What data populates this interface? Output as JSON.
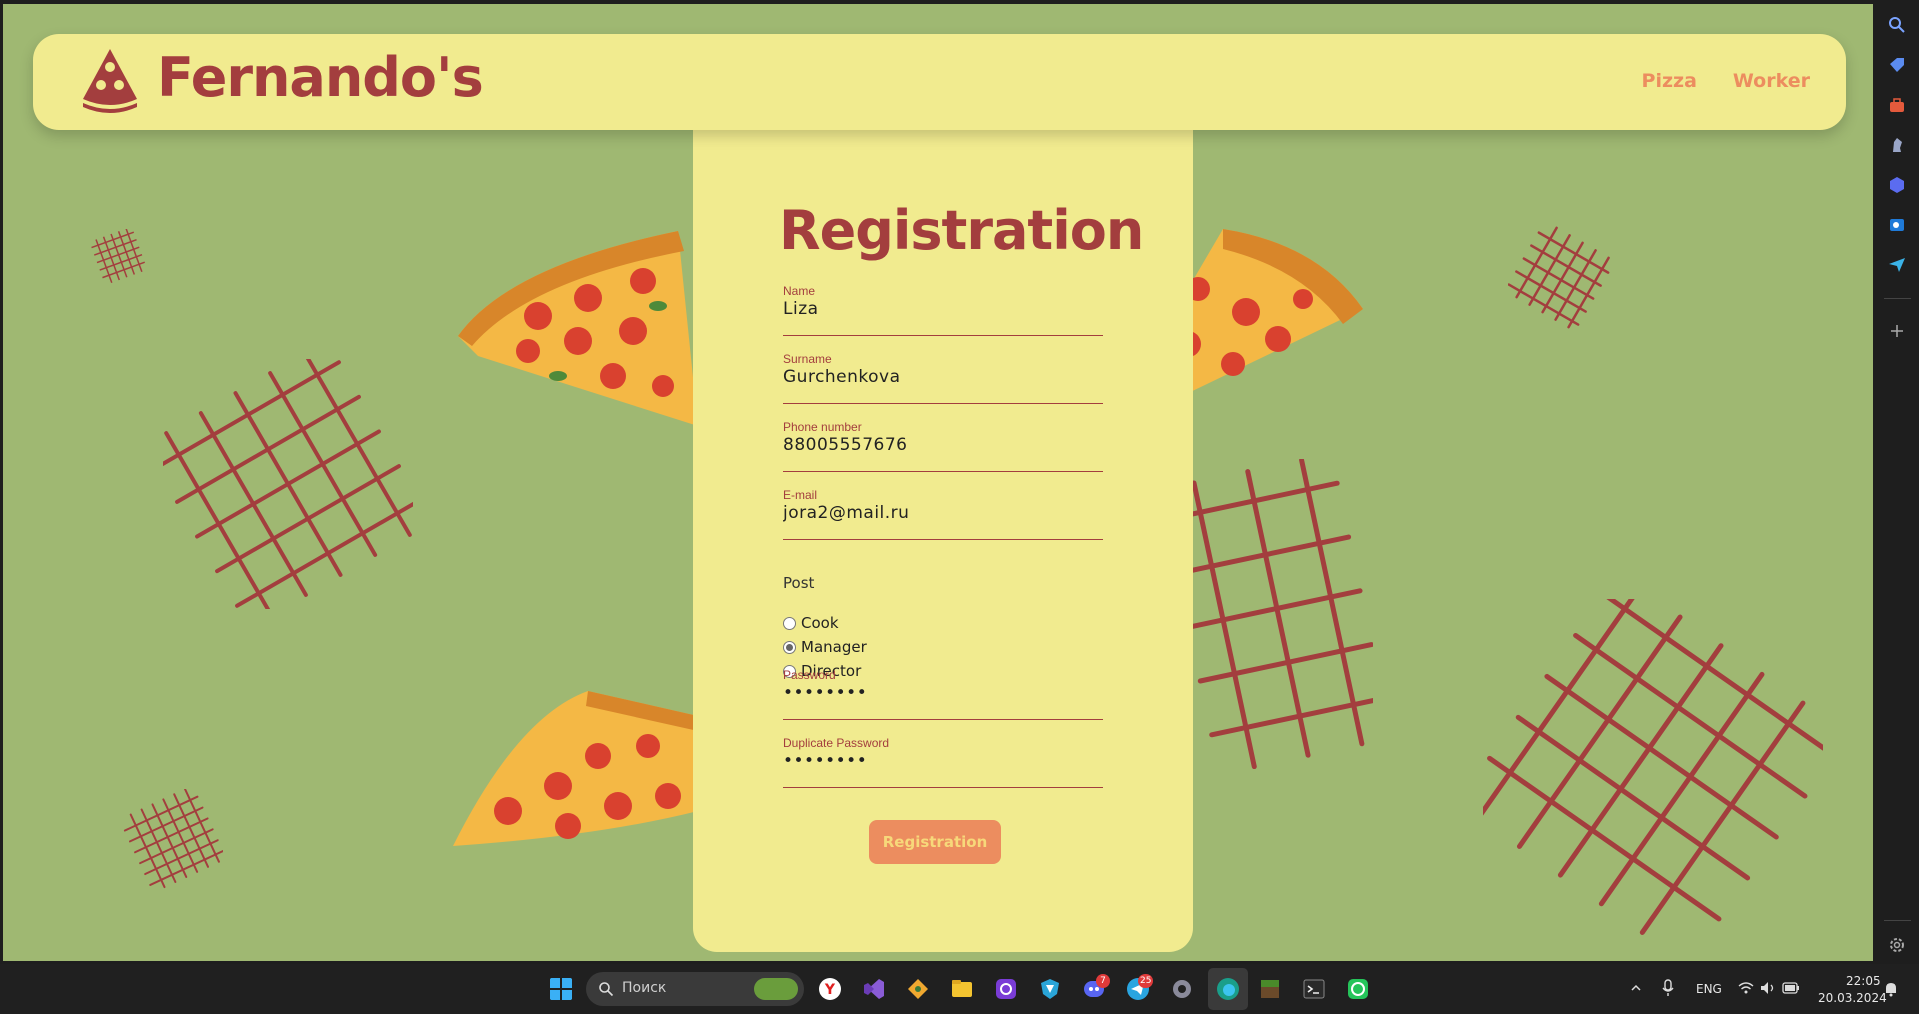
{
  "header": {
    "brand": "Fernando's",
    "nav": [
      "Pizza",
      "Worker"
    ]
  },
  "form": {
    "title": "Registration",
    "fields": [
      {
        "label": "Name",
        "value": "Liza"
      },
      {
        "label": "Surname",
        "value": "Gurchenkova"
      },
      {
        "label": "Phone number",
        "value": "88005557676"
      },
      {
        "label": "E-mail",
        "value": "jora2@mail.ru"
      }
    ],
    "post_label": "Post",
    "post_options": [
      "Cook",
      "Manager",
      "Director"
    ],
    "post_selected": "Manager",
    "password": {
      "label": "Password",
      "value": "12345678"
    },
    "duplicate_password": {
      "label": "Duplicate Password",
      "value": "12345678"
    },
    "submit_label": "Registration"
  },
  "taskbar": {
    "search_placeholder": "Поиск",
    "language": "ENG",
    "time": "22:05",
    "date": "20.03.2024",
    "discord_badge": "7",
    "telegram_badge": "25"
  },
  "colors": {
    "background": "#9fb872",
    "panel": "#f1eb8f",
    "accent": "#a33e3e",
    "button": "#ec8d5f"
  },
  "icons": {
    "sidebar": [
      "search-icon",
      "tag-icon",
      "toolbox-icon",
      "chess-icon",
      "copilot-icon",
      "outlook-icon",
      "send-icon",
      "plus-icon",
      "settings-icon"
    ]
  }
}
